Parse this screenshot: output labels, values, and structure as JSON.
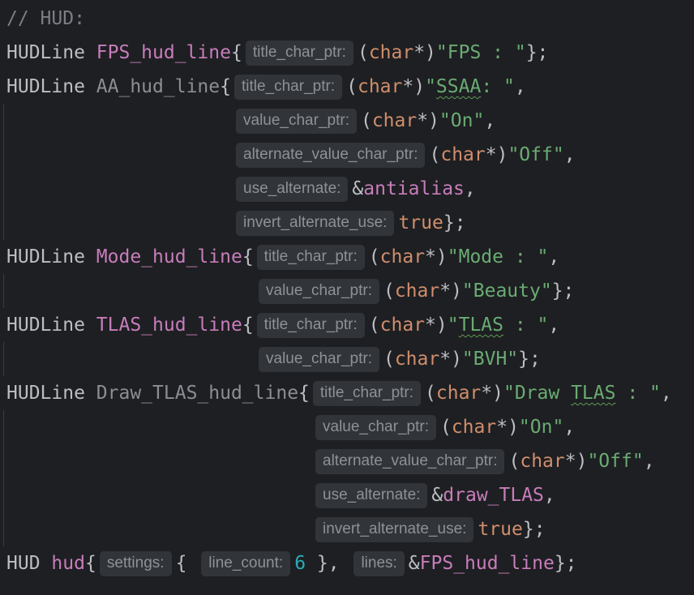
{
  "editor": {
    "colors": {
      "background": "#1e1f22",
      "keyword": "#cf8e6d",
      "string": "#6aab73",
      "variable": "#c77dbb",
      "number": "#2aacb8",
      "hint_bg": "#313438"
    },
    "comment": "// HUD:",
    "type_name": "HUDLine",
    "hud_type": "HUD",
    "char_type": "char",
    "true_kw": "true",
    "hints": {
      "title": "title_char_ptr:",
      "value": "value_char_ptr:",
      "alt_value": "alternate_value_char_ptr:",
      "use_alt": "use_alternate:",
      "invert": "invert_alternate_use:",
      "settings": "settings:",
      "line_count": "line_count:",
      "lines": "lines:"
    },
    "vars": {
      "fps": "FPS_hud_line",
      "aa": "AA_hud_line",
      "mode": "Mode_hud_line",
      "tlas": "TLAS_hud_line",
      "draw_tlas": "Draw_TLAS_hud_line",
      "hud": "hud",
      "antialias": "antialias",
      "draw_tlas_flag": "draw_TLAS"
    },
    "strings": {
      "fps": "\"FPS : \"",
      "ssaa_q": "\"",
      "ssaa": "SSAA",
      "ssaa_rest": ": \"",
      "on": "\"On\"",
      "off": "\"Off\"",
      "mode": "\"Mode : \"",
      "beauty": "\"Beauty\"",
      "tlas_q": "\"",
      "tlas": "TLAS",
      "tlas_rest": " : \"",
      "bvh": "\"BVH\"",
      "draw_a": "\"Draw ",
      "draw_tlas": "TLAS",
      "draw_b": " : \""
    },
    "line_count_value": "6"
  }
}
